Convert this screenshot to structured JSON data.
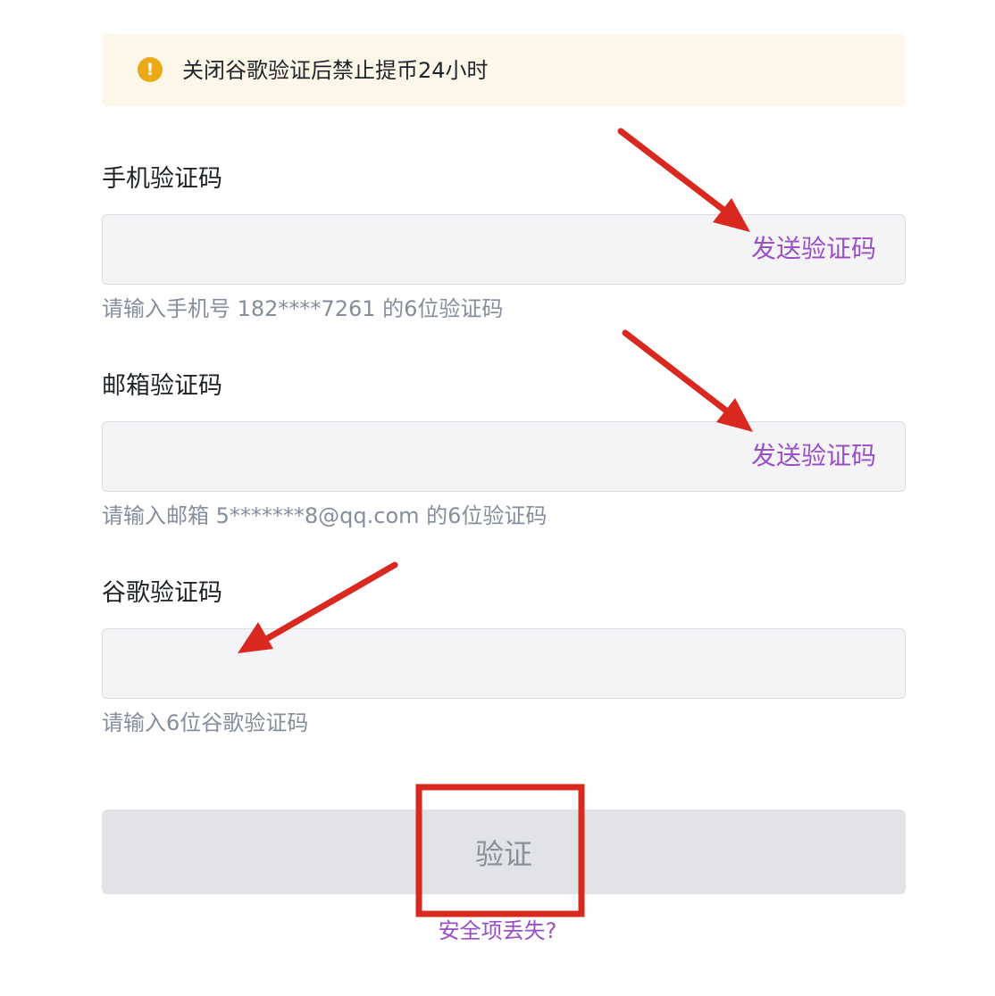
{
  "warning": {
    "icon": "exclamation-icon",
    "text": "关闭谷歌验证后禁止提币24小时",
    "icon_color": "#eaaa16",
    "background": "#fdf7ea"
  },
  "fields": [
    {
      "label": "手机验证码",
      "value": "",
      "send_label": "发送验证码",
      "hint": "请输入手机号 182****7261 的6位验证码"
    },
    {
      "label": "邮箱验证码",
      "value": "",
      "send_label": "发送验证码",
      "hint": "请输入邮箱 5*******8@qq.com 的6位验证码"
    },
    {
      "label": "谷歌验证码",
      "value": "",
      "hint": "请输入6位谷歌验证码"
    }
  ],
  "verify_button": {
    "label": "验证",
    "enabled": false
  },
  "lost_link": "安全项丢失?",
  "colors": {
    "accent": "#9a4fc6",
    "annotation": "#d8281f"
  }
}
